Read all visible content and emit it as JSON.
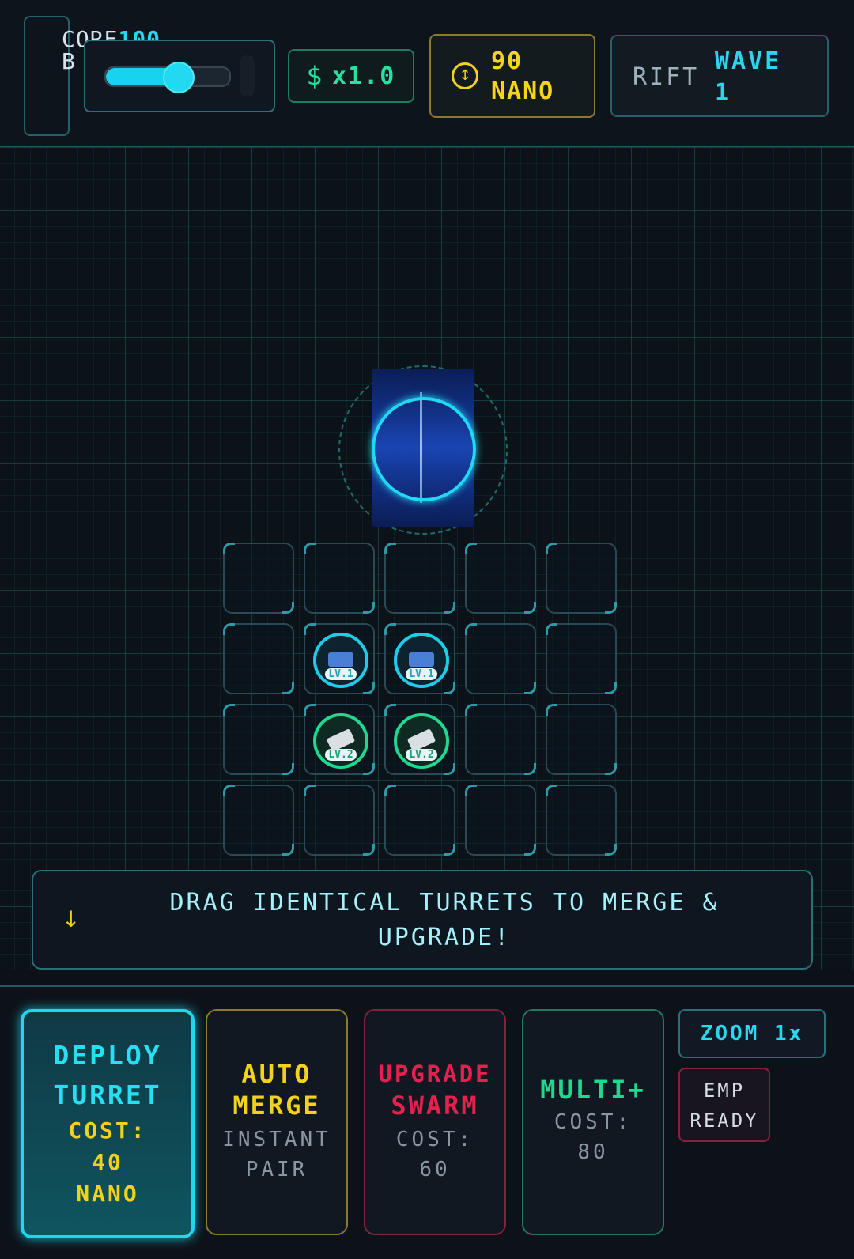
{
  "header": {
    "core_label": "CORE",
    "core_sub": "B",
    "core_value": "100",
    "volume_slider_level": 0.58,
    "speed_icon": "$",
    "speed_value": "x1.0",
    "coin_icon": "↕",
    "nano_amount": "90",
    "nano_unit": "NANO",
    "rift_label": "RIFT",
    "wave_label": "WAVE",
    "wave_number": "1"
  },
  "board": {
    "rows": 4,
    "cols": 5,
    "turrets": [
      {
        "row": 1,
        "col": 1,
        "type": "blue",
        "level_label": "LV.1"
      },
      {
        "row": 1,
        "col": 2,
        "type": "blue",
        "level_label": "LV.1"
      },
      {
        "row": 2,
        "col": 1,
        "type": "green",
        "level_label": "LV.2"
      },
      {
        "row": 2,
        "col": 2,
        "type": "green",
        "level_label": "LV.2"
      }
    ]
  },
  "hint": {
    "arrow_icon": "↓",
    "text": "DRAG IDENTICAL TURRETS TO MERGE & UPGRADE!"
  },
  "actions": {
    "deploy": {
      "title1": "DEPLOY",
      "title2": "TURRET",
      "cost1": "COST:",
      "cost2": "40",
      "cost3": "NANO"
    },
    "auto_merge": {
      "title1": "AUTO",
      "title2": "MERGE",
      "sub1": "INSTANT",
      "sub2": "PAIR"
    },
    "upgrade": {
      "title1": "UPGRADE",
      "title2": "SWARM",
      "sub1": "COST:",
      "sub2": "60"
    },
    "multi": {
      "title1": "MULTI+",
      "sub1": "COST:",
      "sub2": "80"
    },
    "zoom_label": "ZOOM 1x",
    "emp_line1": "EMP",
    "emp_line2": "READY"
  },
  "colors": {
    "cyan": "#1fd8f0",
    "gold": "#f2d21c",
    "green": "#20d890",
    "red": "#e8204e"
  }
}
